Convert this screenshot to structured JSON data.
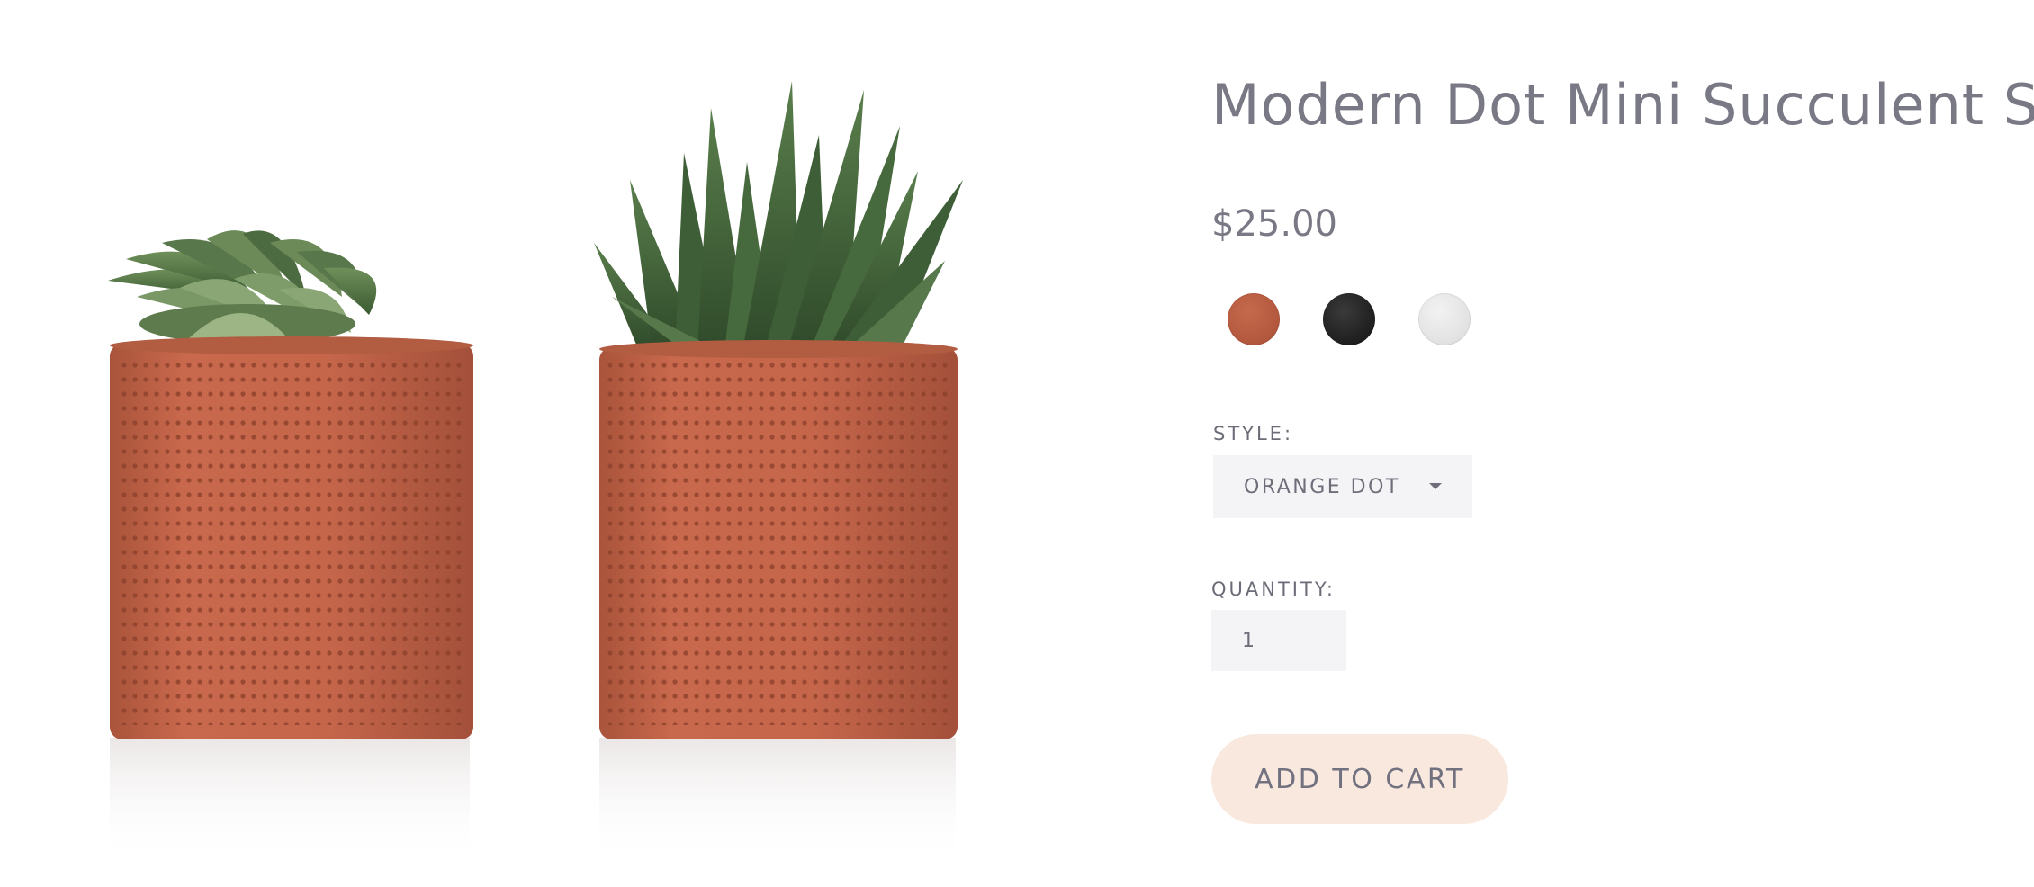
{
  "product": {
    "title": "Modern Dot Mini Succulent Set",
    "price": "$25.00"
  },
  "swatches": [
    {
      "name": "Orange Dot",
      "color": "#b55a3f",
      "selected": true
    },
    {
      "name": "Black Dot",
      "color": "#222222",
      "selected": false
    },
    {
      "name": "White Dot",
      "color": "#e4e4e4",
      "selected": false
    }
  ],
  "style_field": {
    "label": "STYLE:",
    "selected_value": "ORANGE DOT"
  },
  "quantity_field": {
    "label": "QUANTITY:",
    "value": "1"
  },
  "cart": {
    "button_label": "ADD TO CART"
  },
  "colors": {
    "text": "#797986",
    "pot_terracotta": "#c0654a",
    "button_bg": "#f9e8dd",
    "field_bg": "#f4f3f5"
  },
  "icons": {
    "select_caret": "chevron-down-icon"
  }
}
